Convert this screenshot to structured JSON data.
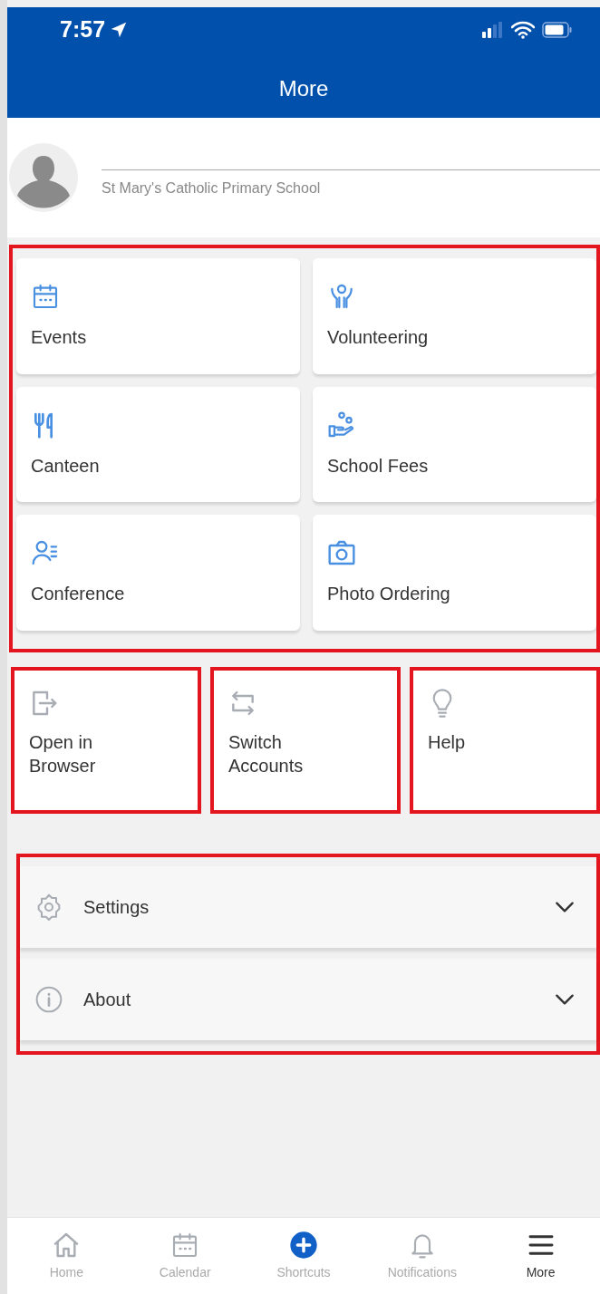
{
  "status_bar": {
    "time": "7:57"
  },
  "header": {
    "title": "More"
  },
  "profile": {
    "name_line": "St Mary's Catholic Primary School"
  },
  "modules": {
    "highlighted": true,
    "items": [
      {
        "label": "Events",
        "kind": "calendar"
      },
      {
        "label": "Volunteering",
        "kind": "volunteer"
      },
      {
        "label": "Canteen",
        "kind": "cutlery"
      },
      {
        "label": "School Fees",
        "kind": "fees"
      },
      {
        "label": "Conference",
        "kind": "conference"
      },
      {
        "label": "Photo Ordering",
        "kind": "camera"
      }
    ]
  },
  "shortcuts": [
    {
      "label": "Open in\nBrowser",
      "kind": "exit",
      "highlighted": true
    },
    {
      "label": "Switch\nAccounts",
      "kind": "switch",
      "highlighted": true
    },
    {
      "label": "Help",
      "kind": "bulb",
      "highlighted": true
    }
  ],
  "accordion": {
    "highlighted": true,
    "items": [
      {
        "label": "Settings",
        "kind": "gear",
        "expanded": false
      },
      {
        "label": "About",
        "kind": "info",
        "expanded": false
      }
    ]
  },
  "tab_bar": [
    {
      "label": "Home",
      "kind": "home",
      "selected": false
    },
    {
      "label": "Calendar",
      "kind": "calendar",
      "selected": false
    },
    {
      "label": "Shortcuts",
      "kind": "plus",
      "selected": false
    },
    {
      "label": "Notifications",
      "kind": "bell",
      "selected": false
    },
    {
      "label": "More",
      "kind": "menu",
      "selected": true
    }
  ]
}
